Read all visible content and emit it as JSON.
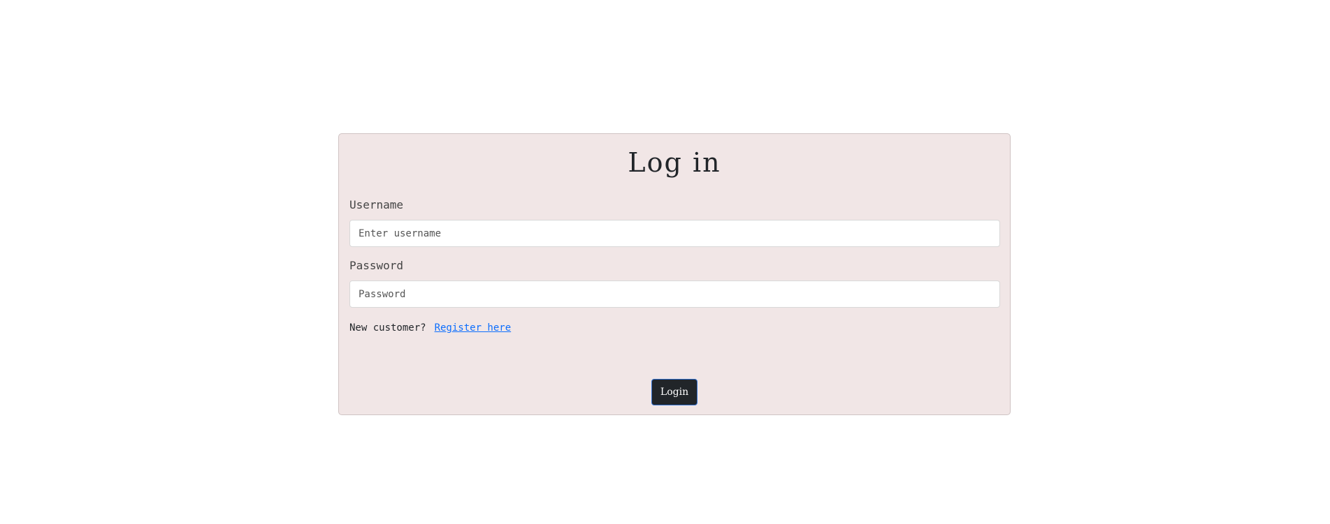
{
  "form": {
    "title": "Log in",
    "username_label": "Username",
    "username_placeholder": "Enter username",
    "username_value": "",
    "password_label": "Password",
    "password_placeholder": "Password",
    "password_value": "",
    "new_customer_text": "New customer?",
    "register_link": "Register here",
    "login_button": "Login"
  },
  "colors": {
    "card_background": "#f1e6e6",
    "button_background": "#212529",
    "link": "#0d6efd"
  }
}
